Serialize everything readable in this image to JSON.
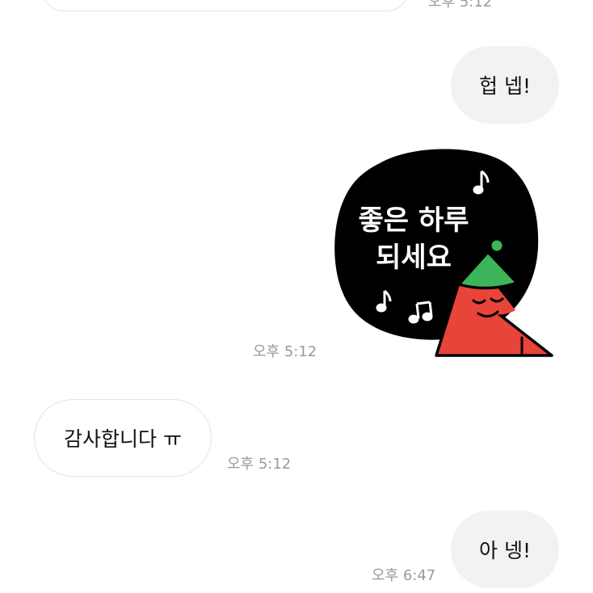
{
  "messages": [
    {
      "id": "m0",
      "direction": "incoming",
      "text": "",
      "time": "오후 5:12"
    },
    {
      "id": "m1",
      "direction": "outgoing",
      "text": "헙 넵!"
    },
    {
      "id": "m2",
      "direction": "outgoing",
      "type": "sticker",
      "sticker_text_line1": "좋은 하루",
      "sticker_text_line2": "되세요",
      "time": "오후 5:12"
    },
    {
      "id": "m3",
      "direction": "incoming",
      "text": "감사합니다 ㅠ",
      "time": "오후 5:12"
    },
    {
      "id": "m4",
      "direction": "outgoing",
      "text": "아 넹!",
      "time": "오후 6:47"
    }
  ],
  "colors": {
    "incoming_bubble_bg": "#ffffff",
    "incoming_bubble_border": "#e3e3e3",
    "outgoing_bubble_bg": "#f2f2f2",
    "timestamp": "#9a9a9a",
    "sticker_blob": "#000000",
    "sticker_character_red": "#e8443a",
    "sticker_hat_green": "#3cb55a"
  }
}
